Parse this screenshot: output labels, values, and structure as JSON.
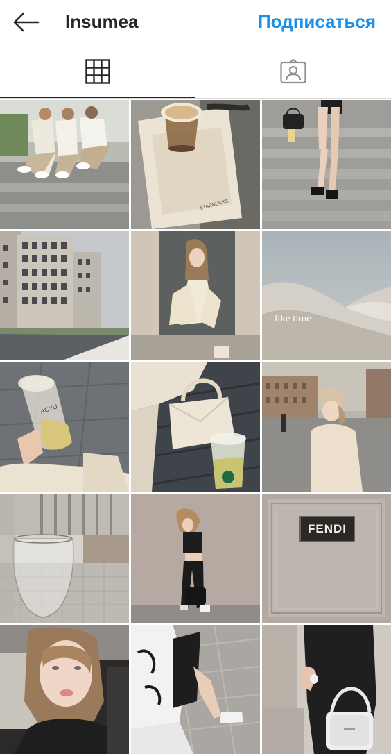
{
  "header": {
    "title": "Insumea",
    "follow_label": "Подписаться",
    "back_icon": "arrow-left-icon"
  },
  "tabs": [
    {
      "name": "grid",
      "icon": "grid-icon",
      "active": true
    },
    {
      "name": "tagged",
      "icon": "tagged-person-icon",
      "active": false
    }
  ],
  "posts": [
    {
      "subject": "three-girls-on-steps"
    },
    {
      "subject": "starbucks-iced-coffee"
    },
    {
      "subject": "legs-on-steps-with-bag"
    },
    {
      "subject": "apartment-buildings"
    },
    {
      "subject": "girl-cream-outfit"
    },
    {
      "subject": "sand-dunes",
      "overlay_text": "like time"
    },
    {
      "subject": "hand-with-cup",
      "cup_text": "ACYU"
    },
    {
      "subject": "bag-and-drink"
    },
    {
      "subject": "girl-in-beret"
    },
    {
      "subject": "wine-glass"
    },
    {
      "subject": "girl-by-wall"
    },
    {
      "subject": "fendi-sign",
      "sign_text": "FENDI"
    },
    {
      "subject": "selfie-in-car"
    },
    {
      "subject": "nike-sleeve-walk"
    },
    {
      "subject": "white-handbag"
    }
  ],
  "colors": {
    "accent": "#1d8fe6",
    "text": "#262626",
    "divider": "#dbdbdb"
  }
}
